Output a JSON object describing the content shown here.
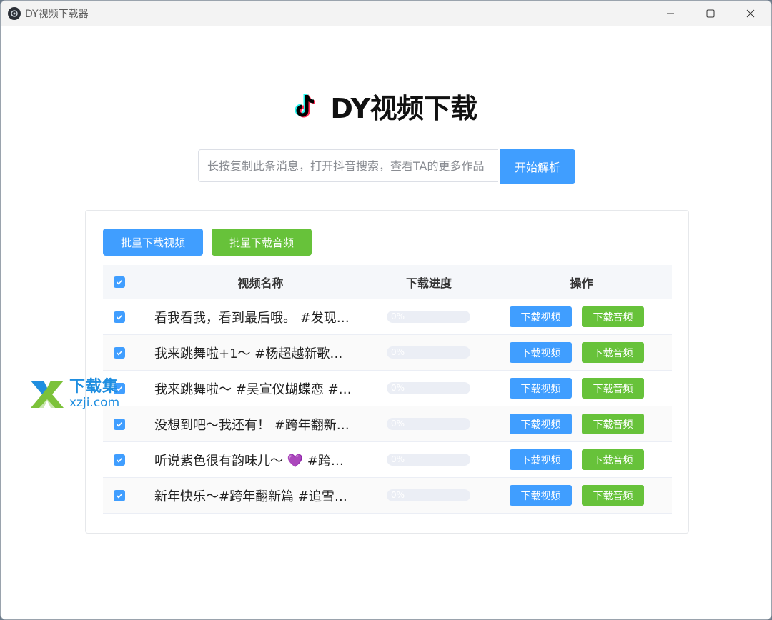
{
  "window": {
    "title": "DY视频下载器"
  },
  "header": {
    "title": "DY视频下载"
  },
  "search": {
    "placeholder": "长按复制此条消息，打开抖音搜索，查看TA的更多作品",
    "button_label": "开始解析"
  },
  "batch": {
    "video_label": "批量下载视频",
    "audio_label": "批量下载音频"
  },
  "table": {
    "columns": [
      "视频名称",
      "下载进度",
      "操作"
    ],
    "rows": [
      {
        "name": "看我看我，看到最后哦。 #发现…",
        "progress": 0,
        "progress_text": "0%",
        "checked": true
      },
      {
        "name": "我来跳舞啦+1～ #杨超越新歌…",
        "progress": 0,
        "progress_text": "0%",
        "checked": true
      },
      {
        "name": "我来跳舞啦～ #吴宣仪蝴蝶恋 #…",
        "progress": 0,
        "progress_text": "0%",
        "checked": true
      },
      {
        "name": "没想到吧～我还有！ #跨年翻新…",
        "progress": 0,
        "progress_text": "0%",
        "checked": true
      },
      {
        "name": "听说紫色很有韵味儿～ 💜 #跨…",
        "progress": 0,
        "progress_text": "0%",
        "checked": true
      },
      {
        "name": "新年快乐～#跨年翻新篇 #追雪…",
        "progress": 0,
        "progress_text": "0%",
        "checked": true
      }
    ],
    "row_video_label": "下载视频",
    "row_audio_label": "下载音频"
  },
  "watermark": {
    "line1": "下载集",
    "line2": "xzji.com"
  },
  "colors": {
    "primary": "#409eff",
    "success": "#67c23a"
  },
  "icons": [
    "app-icon",
    "tiktok-logo-icon",
    "minimize-icon",
    "maximize-icon",
    "close-icon",
    "check-icon"
  ]
}
